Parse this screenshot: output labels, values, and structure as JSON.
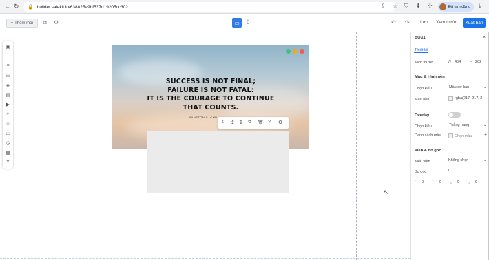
{
  "browser": {
    "url": "builder.salekit.io/638825a9bf537d19205cc302",
    "profile_label": "Đã tạm dừng"
  },
  "toolbar": {
    "add_label": "Thêm mới",
    "save_label": "Lưu",
    "preview_label": "Xem trước",
    "publish_label": "Xuất bản"
  },
  "hero": {
    "quote_lines": [
      "SUCCESS IS NOT FINAL;",
      "FAILURE IS NOT FATAL:",
      "IT IS THE COURAGE TO CONTINUE",
      "THAT COUNTS."
    ],
    "author": "WINSTON S. CHU",
    "dot_colors": [
      "#3fc37a",
      "#f5a623",
      "#f05a4f"
    ]
  },
  "panel": {
    "title": "BOX1",
    "tab_label": "Thiết kế",
    "size": {
      "label": "Kích thước",
      "w_label": "W",
      "w_value": "454",
      "h_label": "H",
      "h_value": "202"
    },
    "background": {
      "heading": "Màu & Hình nền",
      "choose_type_label": "Chọn kiểu",
      "choose_type_value": "Màu cơ bản",
      "color_label": "Màu nền",
      "color_value": "rgba(217, 217, 2"
    },
    "overlay": {
      "heading": "Overlay",
      "choose_type_label": "Chọn kiểu",
      "choose_type_value": "Thẳng hàng",
      "color_list_label": "Danh sách màu",
      "color_pick_label": "Chọn màu"
    },
    "border": {
      "heading": "Viền & bo góc",
      "style_label": "Kiểu viền",
      "style_value": "Không chọn",
      "radius_label": "Bo góc",
      "radius_value": "0",
      "corner_values": [
        "0",
        "0",
        "0",
        "0"
      ]
    }
  },
  "colors": {
    "accent": "#1a73e8",
    "selection": "#2f6fd8"
  }
}
